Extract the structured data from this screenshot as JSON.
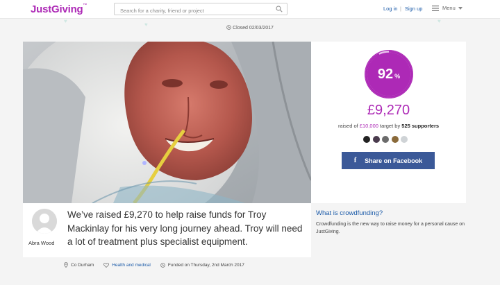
{
  "header": {
    "logo": "JustGiving",
    "logo_tm": "™",
    "search_placeholder": "Search for a charity, friend or project",
    "login": "Log in",
    "separator": "|",
    "signup": "Sign up",
    "menu": "Menu"
  },
  "status": {
    "closed": "Closed 02/03/2017"
  },
  "progress": {
    "percent": "92",
    "percent_sign": "%",
    "fraction": 0.927,
    "amount": "£9,270",
    "raised_prefix": "raised of ",
    "target": "£10,000",
    "target_mid": " target by ",
    "supporters": "525 supporters"
  },
  "share": {
    "facebook_label": "Share on Facebook",
    "facebook_glyph": "f"
  },
  "story": {
    "organiser": "Abra Wood",
    "headline": "We’ve raised £9,270 to help raise funds for Troy Mackinlay for his very long journey ahead. Troy will need a lot of treatment plus specialist equipment."
  },
  "crowdfunding": {
    "title": "What is crowdfunding?",
    "description": "Crowdfunding is the new way to raise money for a personal cause on JustGiving."
  },
  "meta": {
    "location": "Co Durham",
    "category": "Health and medical",
    "funded": "Funded on Thursday, 2nd March 2017"
  },
  "colors": {
    "brand": "#ad29b6",
    "link": "#1a5aa8",
    "facebook": "#3b5998"
  }
}
